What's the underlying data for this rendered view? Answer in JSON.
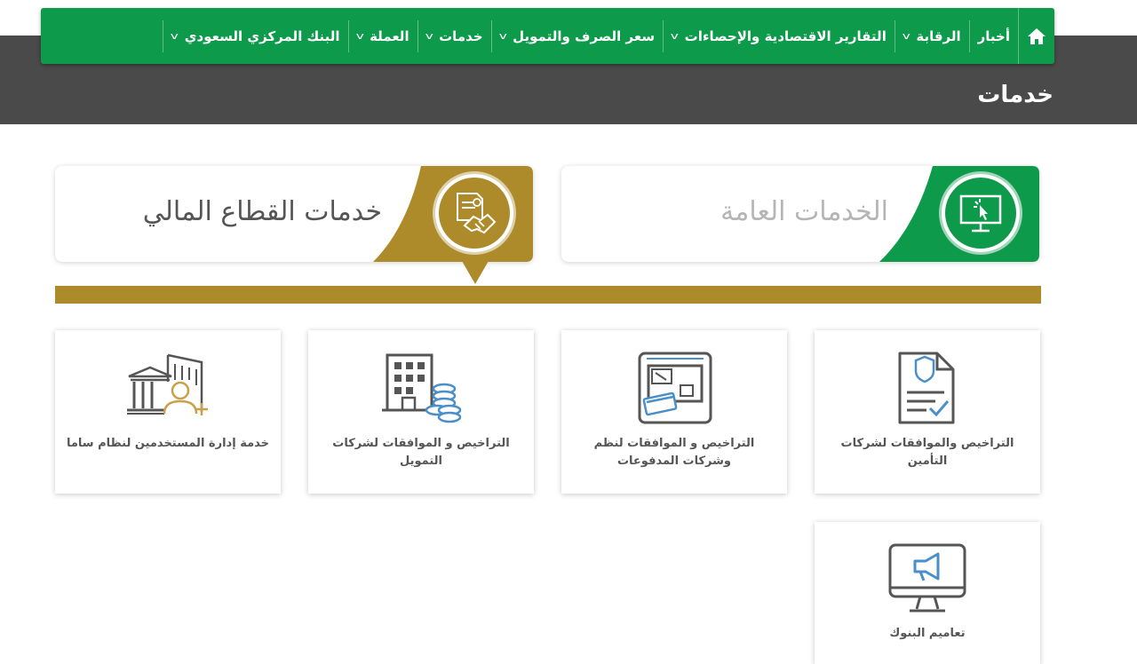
{
  "nav": {
    "home_icon": "home-icon",
    "items": [
      {
        "label": "أخبار",
        "has_dropdown": false
      },
      {
        "label": "الرقابة",
        "has_dropdown": true
      },
      {
        "label": "التقارير الاقتصادية والإحصاءات",
        "has_dropdown": true
      },
      {
        "label": "سعر الصرف والتمويل",
        "has_dropdown": true
      },
      {
        "label": "خدمات",
        "has_dropdown": true
      },
      {
        "label": "العملة",
        "has_dropdown": true
      },
      {
        "label": "البنك المركزي السعودي",
        "has_dropdown": true
      }
    ]
  },
  "page": {
    "title": "خدمات"
  },
  "tabs": {
    "general": {
      "label": "الخدمات العامة",
      "color": "#0e9a4b",
      "icon": "computer-click-icon"
    },
    "financial": {
      "label": "خدمات القطاع المالي",
      "color": "#ad8b2a",
      "icon": "handshake-document-icon",
      "selected": true
    }
  },
  "services": [
    {
      "label": "التراخيص والموافقات لشركات التأمين",
      "icon": "insurance-document-icon"
    },
    {
      "label": "التراخيص و الموافقات لنظم وشركات المدفوعات",
      "icon": "payment-terminal-icon"
    },
    {
      "label": "التراخيص و الموافقات لشركات التمويل",
      "icon": "building-coins-icon"
    },
    {
      "label": "خدمة إدارة المستخدمين لنظام ساما",
      "icon": "bank-add-user-icon"
    },
    {
      "label": "تعاميم البنوك",
      "icon": "monitor-megaphone-icon"
    }
  ],
  "colors": {
    "green": "#0e9a4b",
    "gold": "#ad8b2a",
    "dark_band": "#4a4a4a"
  }
}
